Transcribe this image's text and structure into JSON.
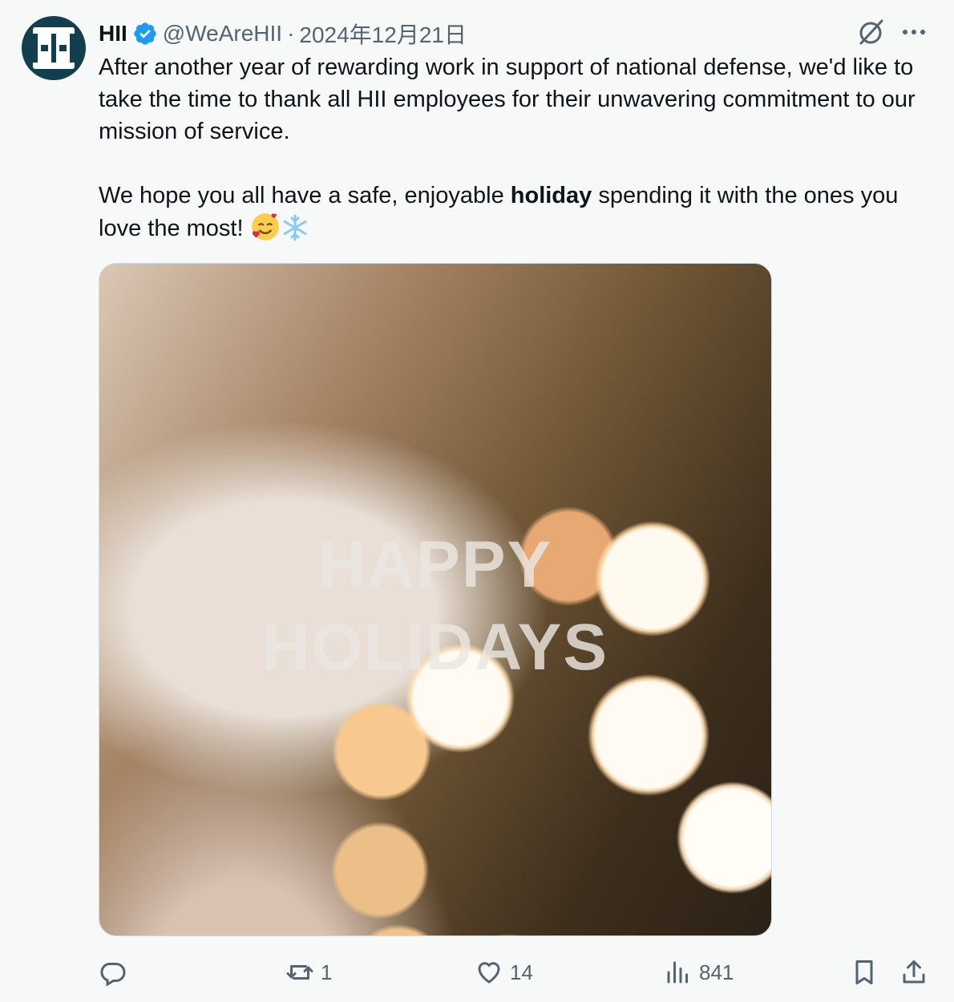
{
  "post": {
    "author_name": "HII",
    "handle": "@WeAreHII",
    "separator": "·",
    "date": "2024年12月21日",
    "paragraph1": "After another year of rewarding work in support of national defense, we'd like to take the time to thank all HII employees for their unwavering commitment to our mission of service.",
    "paragraph2_before": "We hope you all have a safe, enjoyable ",
    "paragraph2_bold": "holiday",
    "paragraph2_after": " spending it with the ones you love the most! ",
    "image_text_line1": "HAPPY",
    "image_text_line2": "HOLIDAYS"
  },
  "actions": {
    "reply_count": "",
    "repost_count": "1",
    "like_count": "14",
    "views_count": "841"
  },
  "icons": [
    "avatar-logo",
    "verified-badge-icon",
    "grok-icon",
    "more-icon",
    "smiling-face-with-hearts-emoji",
    "snowflake-emoji",
    "reply-icon",
    "repost-icon",
    "like-icon",
    "views-icon",
    "bookmark-icon",
    "share-icon"
  ],
  "colors": {
    "verified_blue": "#1d9bf0",
    "secondary_text": "#536471",
    "primary_text": "#0f1419",
    "avatar_bg": "#123f4e"
  }
}
